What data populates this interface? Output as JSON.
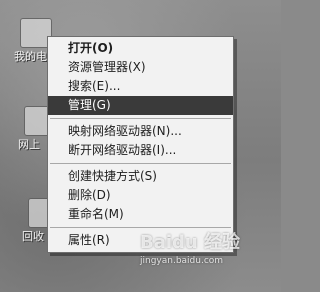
{
  "desktop": {
    "icons": [
      {
        "label": "我的电"
      },
      {
        "label": "网上"
      },
      {
        "label": "回收"
      }
    ]
  },
  "context_menu": {
    "items": [
      {
        "label": "打开(O)"
      },
      {
        "label": "资源管理器(X)"
      },
      {
        "label": "搜索(E)..."
      },
      {
        "label": "管理(G)"
      },
      {
        "label": "映射网络驱动器(N)..."
      },
      {
        "label": "断开网络驱动器(I)..."
      },
      {
        "label": "创建快捷方式(S)"
      },
      {
        "label": "删除(D)"
      },
      {
        "label": "重命名(M)"
      },
      {
        "label": "属性(R)"
      }
    ],
    "highlighted_item": "管理(G)"
  },
  "watermark": {
    "logo_text": "Baidu 经验",
    "url": "jingyan.baidu.com"
  }
}
